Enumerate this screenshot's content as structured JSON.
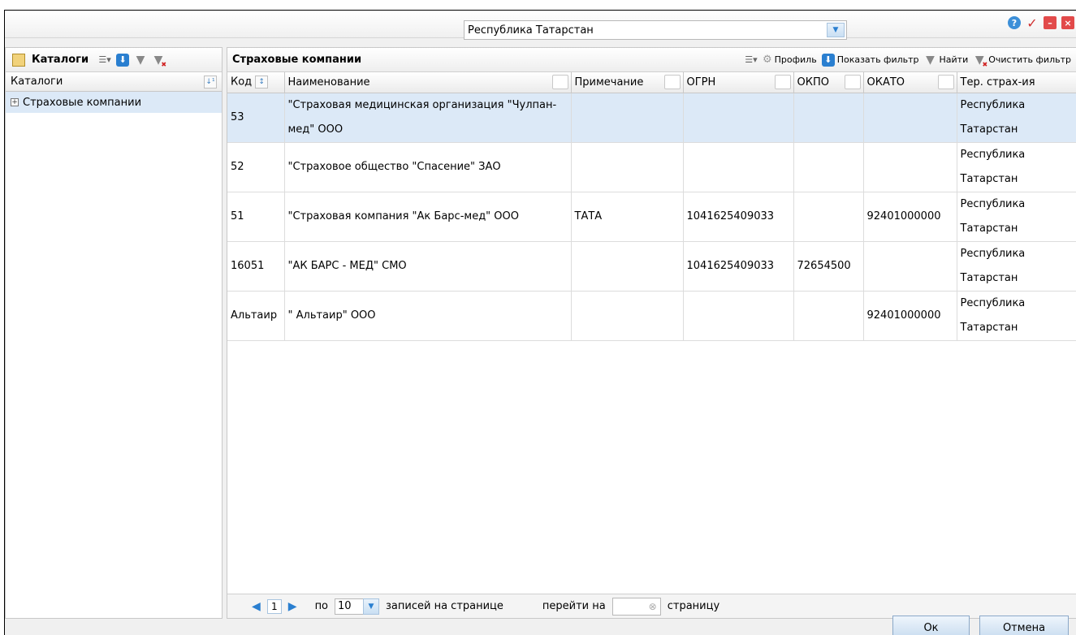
{
  "window": {
    "icons": [
      "help-icon",
      "check-icon",
      "minimize-icon",
      "close-icon"
    ]
  },
  "left_panel": {
    "title": "Каталоги",
    "column_header": "Каталоги",
    "tree_items": [
      {
        "label": "Страховые компании",
        "expander": "+"
      }
    ]
  },
  "region_select": {
    "value": "Республика Татарстан"
  },
  "grid": {
    "title": "Страховые компании",
    "toolbar": {
      "profile": "Профиль",
      "show_filter": "Показать фильтр",
      "find": "Найти",
      "clear_filter": "Очистить фильтр"
    },
    "columns": [
      "Код",
      "Наименование",
      "Примечание",
      "ОГРН",
      "ОКПО",
      "ОКАТО",
      "Тер. страх-ия"
    ],
    "rows": [
      {
        "code": "53",
        "name": "\"Страховая медицинская организация \"Чулпан-мед\" ООО",
        "note": "",
        "ogrn": "",
        "okpo": "",
        "okato": "",
        "territory": "Республика Татарстан",
        "selected": true
      },
      {
        "code": "52",
        "name": "\"Страховое общество \"Спасение\" ЗАО",
        "note": "",
        "ogrn": "",
        "okpo": "",
        "okato": "",
        "territory": "Республика Татарстан",
        "selected": false
      },
      {
        "code": "51",
        "name": "\"Страховая компания \"Ак Барс-мед\" ООО",
        "note": "ТАТА",
        "ogrn": "1041625409033",
        "okpo": "",
        "okato": "92401000000",
        "territory": "Республика Татарстан",
        "selected": false
      },
      {
        "code": "16051",
        "name": "\"АК БАРС - МЕД\" СМО",
        "note": "",
        "ogrn": "1041625409033",
        "okpo": "72654500",
        "okato": "",
        "territory": "Республика Татарстан",
        "selected": false
      },
      {
        "code": "Альтаир",
        "name": "\" Альтаир\" ООО",
        "note": "",
        "ogrn": "",
        "okpo": "",
        "okato": "92401000000",
        "territory": "Республика Татарстан",
        "selected": false
      }
    ]
  },
  "pager": {
    "page": "1",
    "per_label_prefix": "по",
    "per_page": "10",
    "per_label_suffix": "записей на странице",
    "goto_prefix": "перейти на",
    "goto_suffix": "страницу"
  },
  "buttons": {
    "ok": "Ок",
    "cancel": "Отмена"
  }
}
